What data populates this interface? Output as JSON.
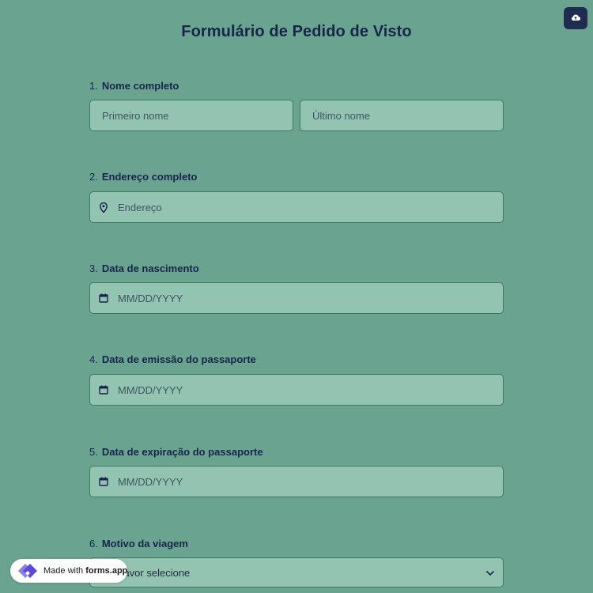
{
  "form": {
    "title": "Formulário de Pedido de Visto"
  },
  "questions": [
    {
      "number": "1.",
      "label": "Nome completo",
      "placeholders": [
        "Primeiro nome",
        "Último nome"
      ]
    },
    {
      "number": "2.",
      "label": "Endereço completo",
      "placeholder": "Endereço",
      "icon": "location-pin-icon"
    },
    {
      "number": "3.",
      "label": "Data de nascimento",
      "placeholder": "MM/DD/YYYY",
      "icon": "calendar-icon"
    },
    {
      "number": "4.",
      "label": "Data de emissão do passaporte",
      "placeholder": "MM/DD/YYYY",
      "icon": "calendar-icon"
    },
    {
      "number": "5.",
      "label": "Data de expiração do passaporte",
      "placeholder": "MM/DD/YYYY",
      "icon": "calendar-icon"
    },
    {
      "number": "6.",
      "label": "Motivo da viagem",
      "placeholder": "Por favor selecione",
      "icon": "chevron-down-icon"
    }
  ],
  "toolbar": {
    "upload_icon": "cloud-upload-icon"
  },
  "badge": {
    "prefix": "Made with ",
    "brand": "forms.app"
  },
  "colors": {
    "background": "#6aa38f",
    "field_background": "#93c4b2",
    "field_border": "#3e7a5c",
    "text_primary": "#17254b",
    "button_dark": "#1f2b4f"
  }
}
